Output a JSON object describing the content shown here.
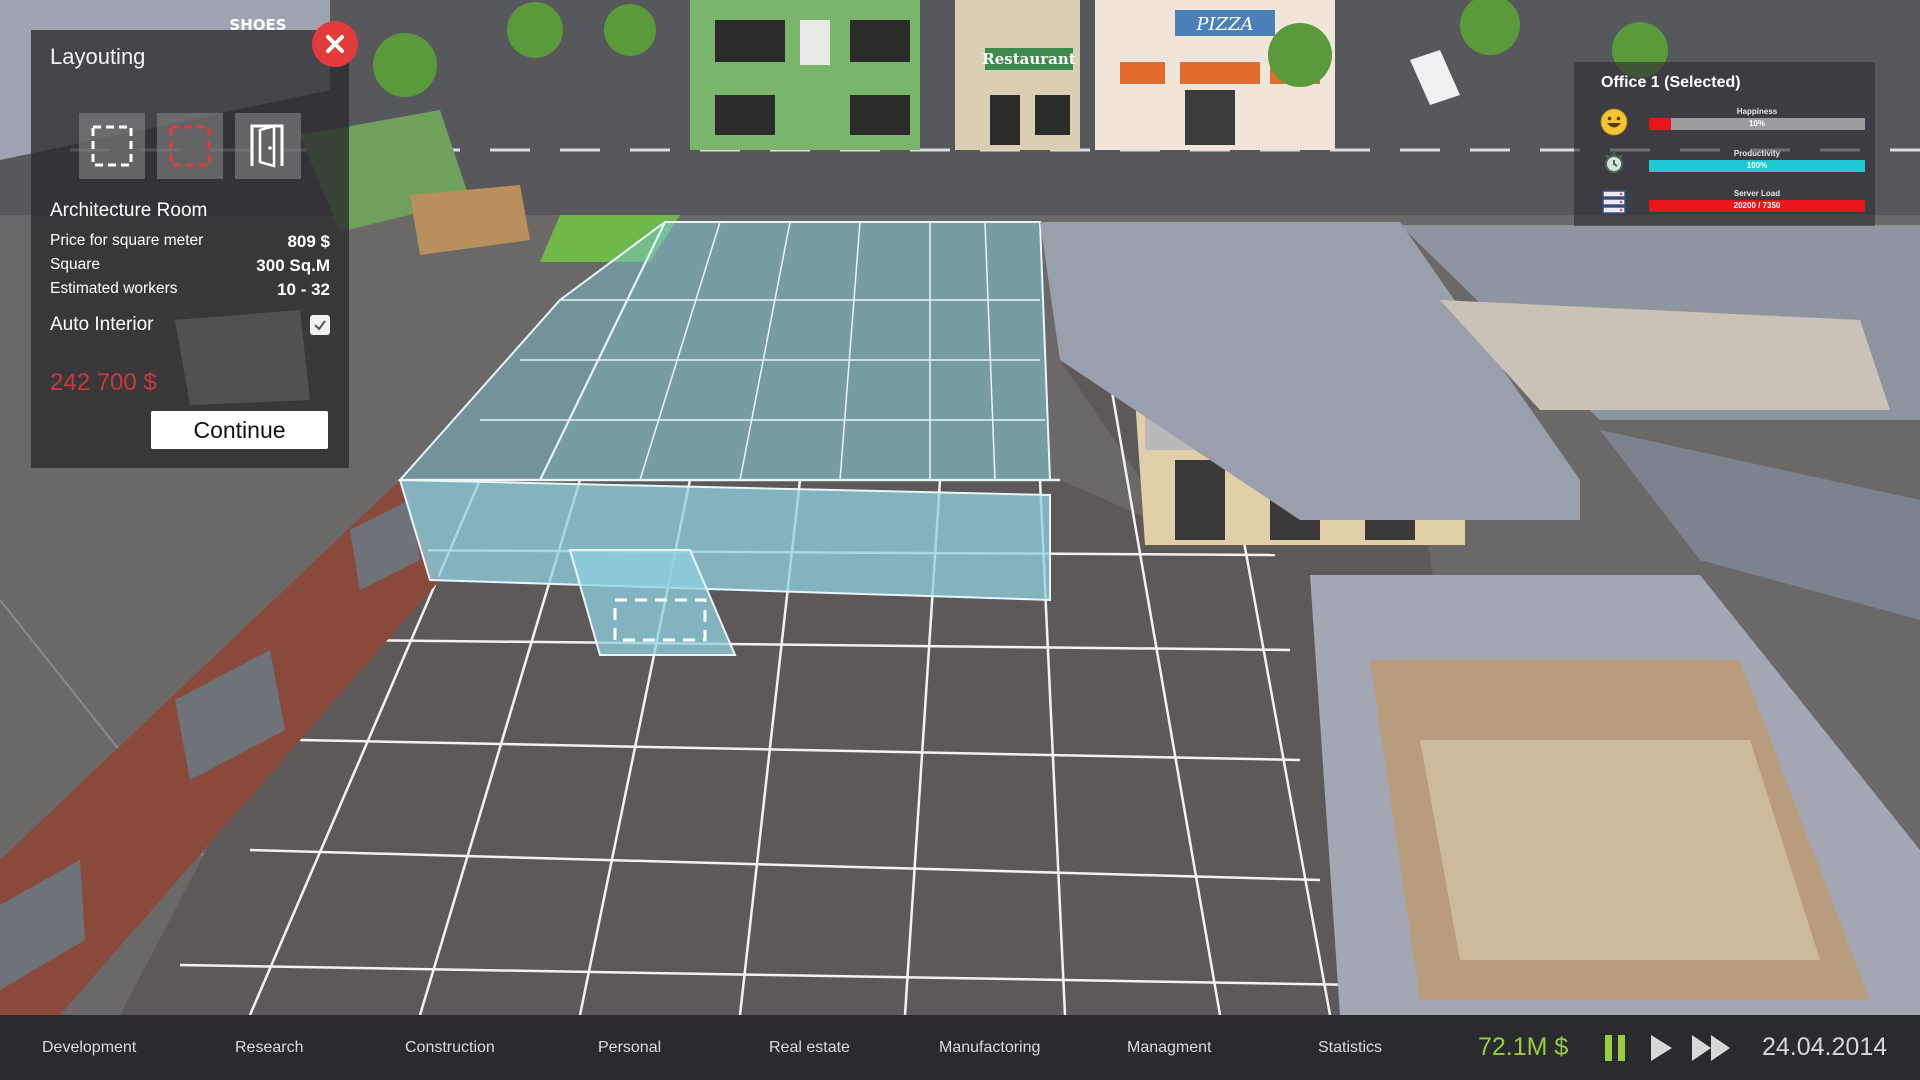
{
  "world": {
    "signs": {
      "shoes": "SHOES",
      "restaurant": "Restaurant",
      "pizza": "PIZZA"
    }
  },
  "layout_panel": {
    "title": "Layouting",
    "close_icon": "close-icon",
    "tools": [
      {
        "name": "select-area-icon"
      },
      {
        "name": "remove-area-icon"
      },
      {
        "name": "door-icon"
      }
    ],
    "room_name": "Architecture Room",
    "rows": [
      {
        "label": "Price for square meter",
        "value": "809 $"
      },
      {
        "label": "Square",
        "value": "300 Sq.M"
      },
      {
        "label": "Estimated workers",
        "value": "10 - 32"
      }
    ],
    "auto_interior_label": "Auto Interior",
    "auto_interior_checked": true,
    "total_price": "242 700 $",
    "continue_label": "Continue"
  },
  "office_panel": {
    "title": "Office 1 (Selected)",
    "stats": [
      {
        "label": "Happiness",
        "text": "10%",
        "fill": 0.1,
        "color": "#e8151b",
        "icon": "smiley-icon"
      },
      {
        "label": "Productivity",
        "text": "100%",
        "fill": 1.0,
        "color": "#1fcad6",
        "icon": "productivity-icon"
      },
      {
        "label": "Server Load",
        "text": "20200 / 7350",
        "fill": 1.0,
        "color": "#e8151b",
        "icon": "server-icon"
      }
    ]
  },
  "bottom_bar": {
    "menu": [
      "Development",
      "Research",
      "Construction",
      "Personal",
      "Real estate",
      "Manufactoring",
      "Managment",
      "Statistics"
    ],
    "money": "72.1M $",
    "date": "24.04.2014"
  },
  "colors": {
    "accent_green": "#9ccc3e",
    "danger_red": "#e23b3b",
    "glass_blue": "#7fc6d6"
  }
}
